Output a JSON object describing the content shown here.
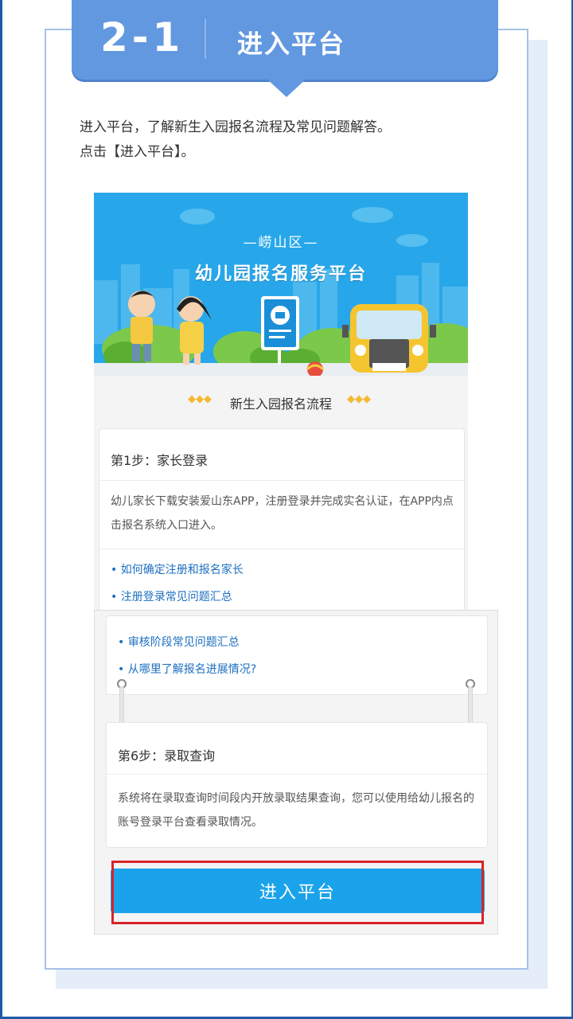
{
  "header": {
    "step_number": "2-1",
    "title": "进入平台"
  },
  "intro": {
    "line1": "进入平台，了解新生入园报名流程及常见问题解答。",
    "line2": "点击【进入平台】。"
  },
  "banner": {
    "region": "—崂山区—",
    "title": "幼儿园报名服务平台"
  },
  "flow": {
    "title": "新生入园报名流程",
    "deco_left": "◆◆◆",
    "deco_right": "◆◆◆"
  },
  "step1": {
    "heading": "第1步：家长登录",
    "body": "幼儿家长下载安装爱山东APP，注册登录并完成实名认证，在APP内点击报名系统入口进入。",
    "links": [
      "• 如何确定注册和报名家长",
      "• 注册登录常见问题汇总"
    ]
  },
  "step_mid": {
    "links": [
      "• 审核阶段常见问题汇总",
      "• 从哪里了解报名进展情况?"
    ]
  },
  "step6": {
    "heading": "第6步：录取查询",
    "body": "系统将在录取查询时间段内开放录取结果查询，您可以使用给幼儿报名的账号登录平台查看录取情况。"
  },
  "enter_button": {
    "label": "进入平台"
  },
  "colors": {
    "header_blue": "#6298e0",
    "button_blue": "#1aa3eb",
    "highlight_red": "#d8232a",
    "link_blue": "#1c6fc0"
  }
}
